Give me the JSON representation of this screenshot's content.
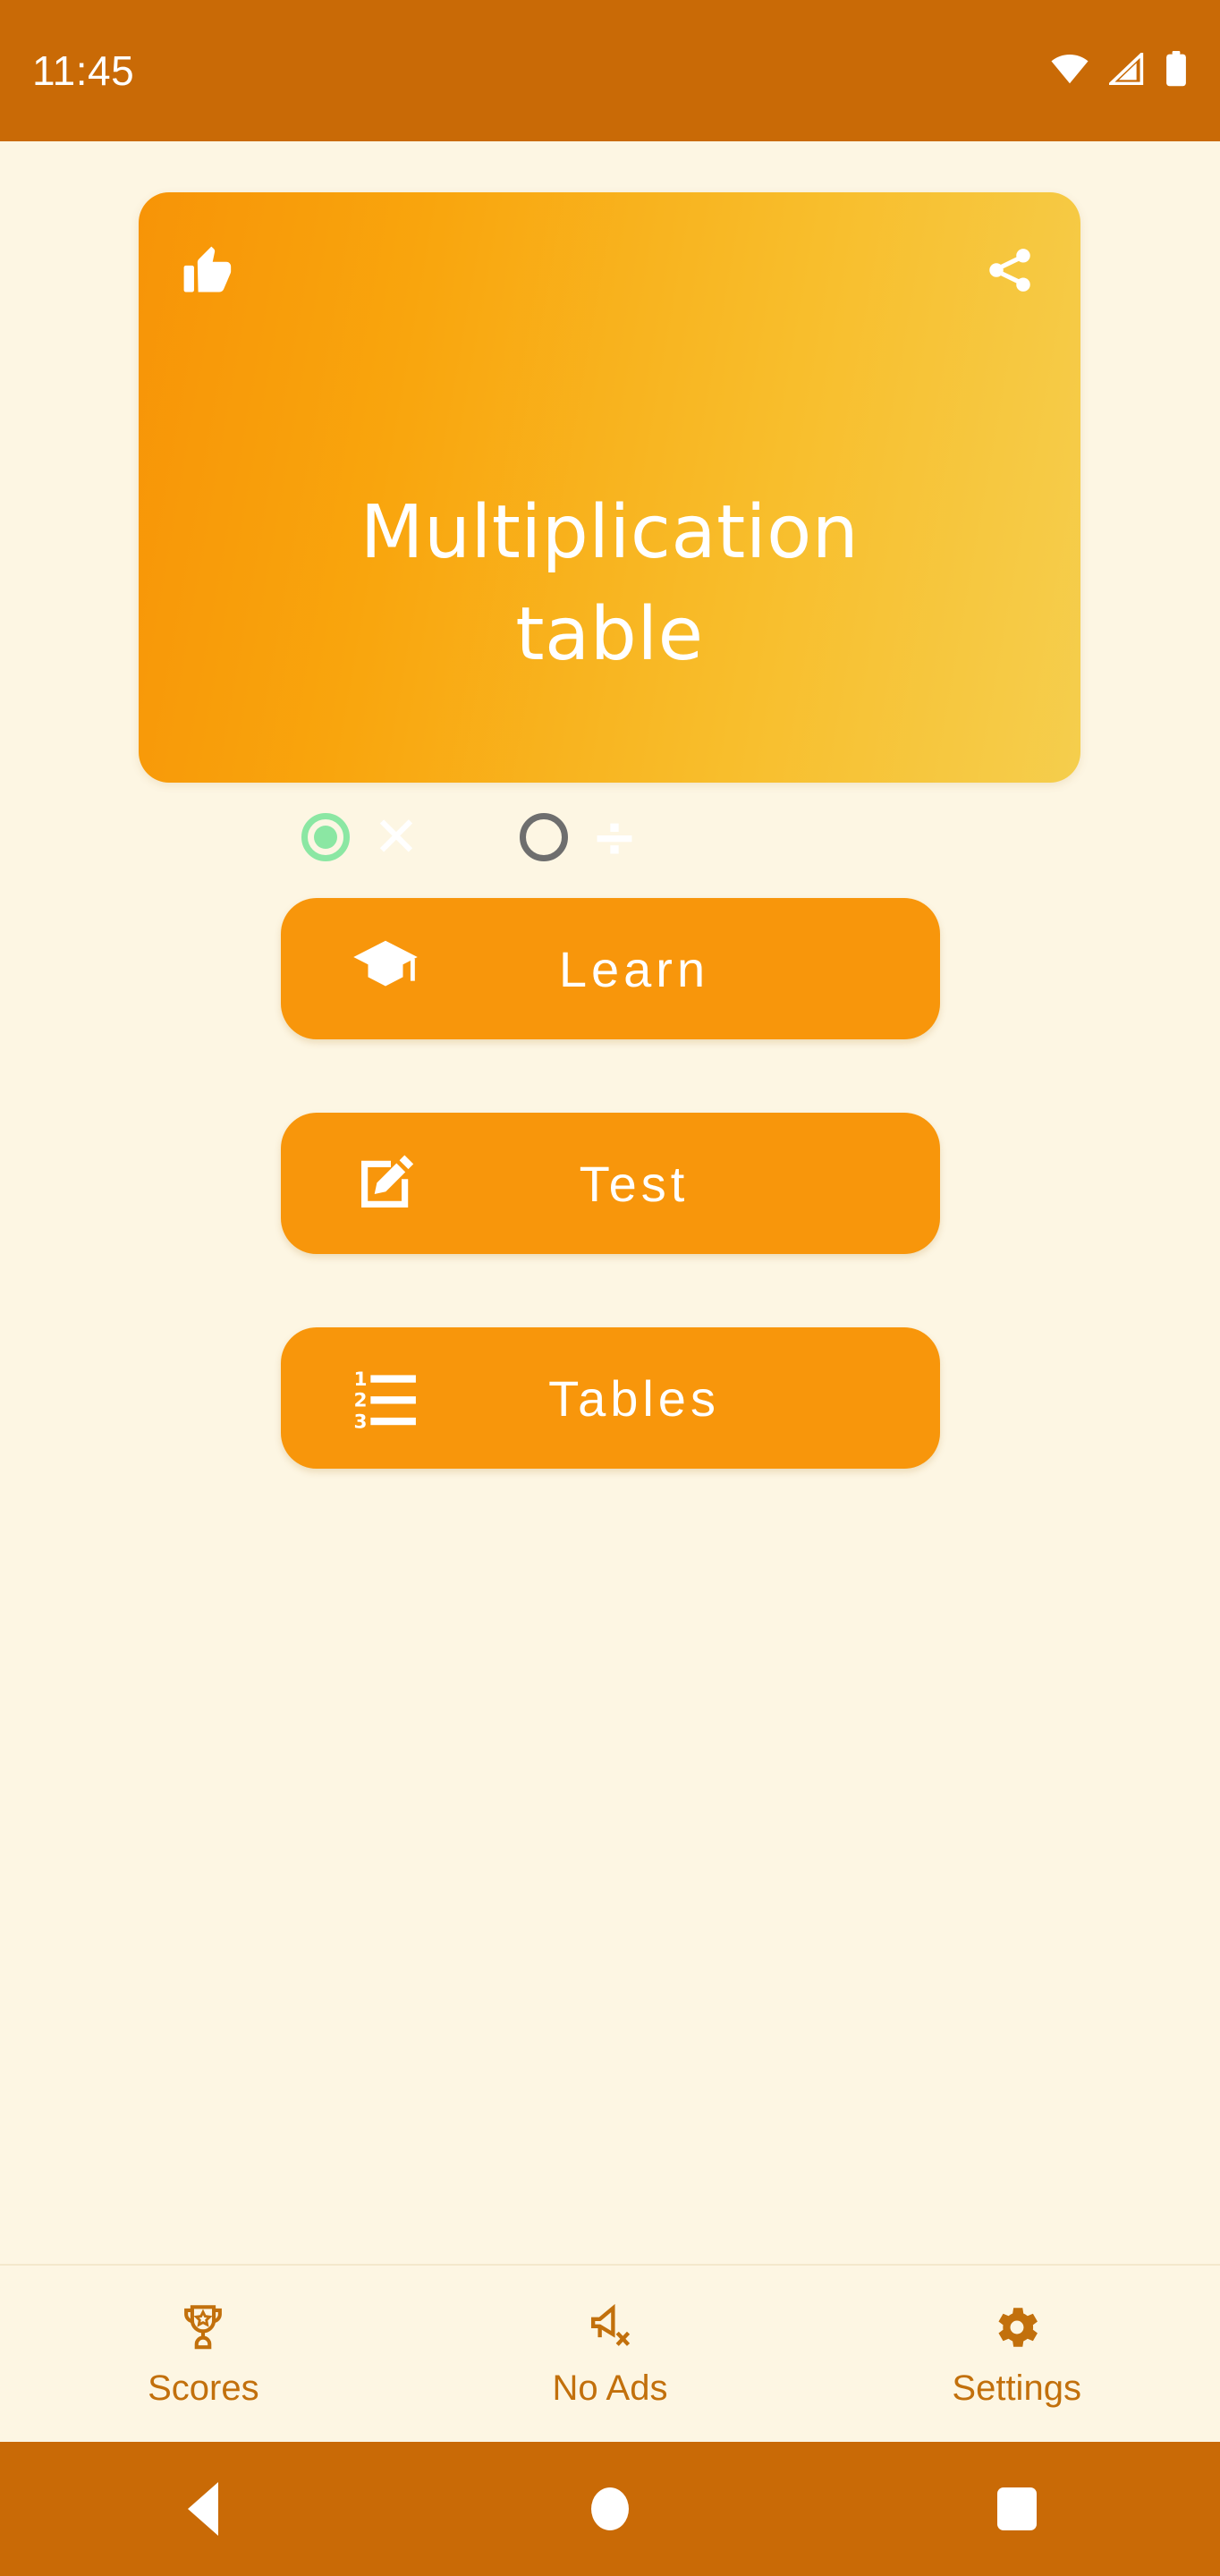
{
  "statusbar": {
    "time": "11:45",
    "icons": [
      "wifi-icon",
      "cellular-signal-icon",
      "battery-icon"
    ]
  },
  "header_card": {
    "title_line1": "Multiplication",
    "title_line2": "table",
    "like_icon": "thumbs-up-icon",
    "share_icon": "share-icon",
    "operations": [
      {
        "id": "multiply",
        "glyph": "✕",
        "selected": true,
        "label": "Multiplication"
      },
      {
        "id": "divide",
        "glyph": "÷",
        "selected": false,
        "label": "Division"
      }
    ],
    "selected_color": "#8BE7A3",
    "unselected_color": "#6E6E6E",
    "gradient_from": "#F79407",
    "gradient_to": "#F5CE4D"
  },
  "actions": [
    {
      "label": "Learn",
      "icon": "graduation-cap-icon"
    },
    {
      "label": "Test",
      "icon": "edit-square-icon"
    },
    {
      "label": "Tables",
      "icon": "numbered-list-icon"
    }
  ],
  "bottom_nav": [
    {
      "label": "Scores",
      "icon": "trophy-icon"
    },
    {
      "label": "No Ads",
      "icon": "no-ads-megaphone-icon"
    },
    {
      "label": "Settings",
      "icon": "gear-icon"
    }
  ],
  "system_nav": [
    {
      "label": "Back",
      "icon": "back-triangle-icon"
    },
    {
      "label": "Home",
      "icon": "home-circle-icon"
    },
    {
      "label": "Recents",
      "icon": "recents-square-icon"
    }
  ],
  "colors": {
    "status_bar": "#C96A06",
    "page_background": "#FDF6E3",
    "button_orange": "#F8960B",
    "nav_label": "#C2700C"
  }
}
